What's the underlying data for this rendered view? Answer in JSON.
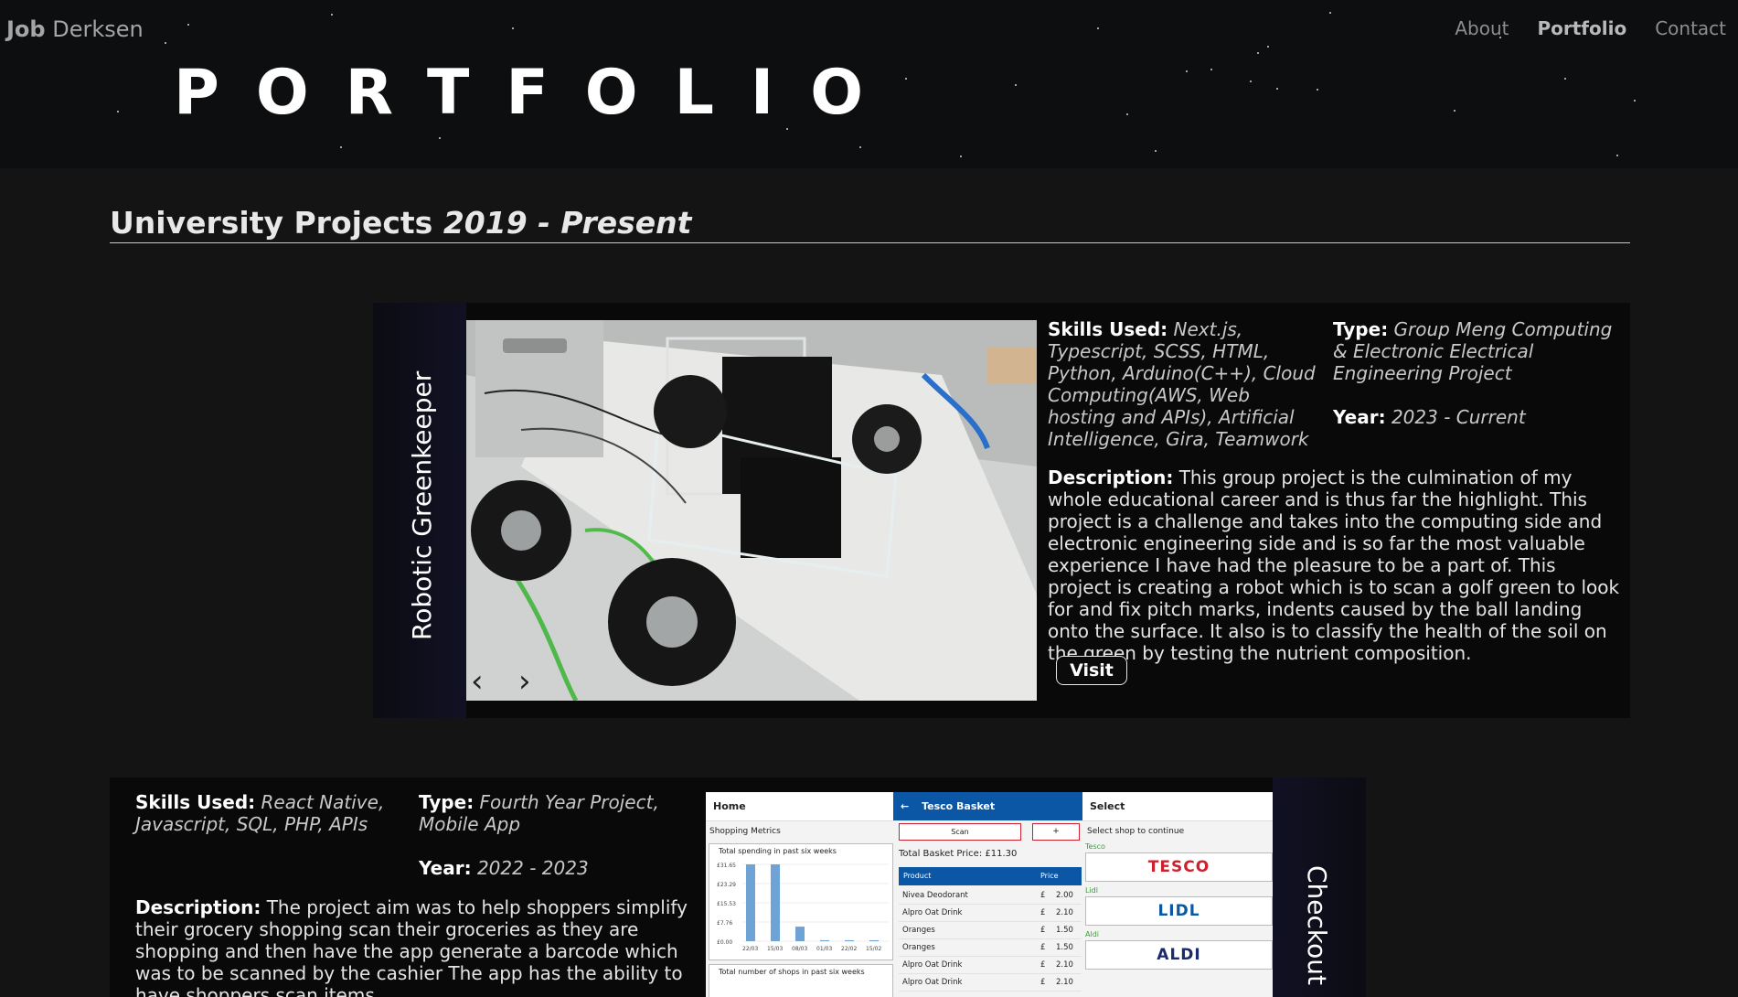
{
  "header": {
    "brand_first": "Job",
    "brand_last": "Derksen",
    "nav": [
      "About",
      "Portfolio",
      "Contact"
    ],
    "active_nav": "Portfolio",
    "title": "PORTFOLIO"
  },
  "section": {
    "title": "University Projects",
    "period": "2019 - Present"
  },
  "project1": {
    "name": "Robotic Greenkeeper",
    "skills_label": "Skills Used:",
    "skills": "Next.js, Typescript, SCSS, HTML, Python, Arduino(C++), Cloud Computing(AWS, Web hosting and APIs), Artificial Intelligence, Gira, Teamwork",
    "type_label": "Type:",
    "type": "Group Meng Computing & Electronic Electrical Engineering Project",
    "year_label": "Year:",
    "year": "2023 - Current",
    "desc_label": "Description:",
    "description": "This group project is the culmination of my whole educational career and is thus far the highlight. This project is a challenge and takes into the computing side and electronic engineering side and is so far the most valuable experience I have had the pleasure to be a part of. This project is creating a robot which is to scan a golf green to look for and fix pitch marks, indents caused by the ball landing onto the surface. It also is to classify the health of the soil on the green by testing the nutrient composition.",
    "visit": "Visit",
    "prev": "‹",
    "next": "›"
  },
  "project2": {
    "name": "Checkout",
    "skills_label": "Skills Used:",
    "skills": "React Native, Javascript, SQL, PHP, APIs",
    "type_label": "Type:",
    "type": "Fourth Year Project, Mobile App",
    "year_label": "Year:",
    "year": "2022 - 2023",
    "desc_label": "Description:",
    "description": "The project aim was to help shoppers simplify their grocery shopping scan their groceries as they are shopping and then have the app generate a barcode which was to be scanned by the cashier The app has the ability to have shoppers scan items",
    "screens": {
      "home": {
        "title": "Home",
        "metrics": "Shopping Metrics",
        "chart1": "Total spending in past six weeks",
        "ticks": [
          "£31.65",
          "£23.29",
          "£15.53",
          "£7.76",
          "£0.00"
        ],
        "xlabels": [
          "22/03",
          "15/03",
          "08/03",
          "01/03",
          "22/02",
          "15/02"
        ],
        "values": [
          31.65,
          31.65,
          6.0,
          0.4,
          0.4,
          0.4
        ],
        "chart2": "Total number of shops in past six weeks"
      },
      "basket": {
        "title": "Tesco Basket",
        "back": "←",
        "scan": "Scan",
        "plus": "+",
        "total": "Total Basket Price: £11.30",
        "col_product": "Product",
        "col_price": "Price",
        "items": [
          {
            "product": "Nivea Deodorant",
            "cur": "£",
            "price": "2.00"
          },
          {
            "product": "Alpro Oat Drink",
            "cur": "£",
            "price": "2.10"
          },
          {
            "product": "Oranges",
            "cur": "£",
            "price": "1.50"
          },
          {
            "product": "Oranges",
            "cur": "£",
            "price": "1.50"
          },
          {
            "product": "Alpro Oat Drink",
            "cur": "£",
            "price": "2.10"
          },
          {
            "product": "Alpro Oat Drink",
            "cur": "£",
            "price": "2.10"
          }
        ]
      },
      "select": {
        "title": "Select",
        "prompt": "Select shop to continue",
        "shops": [
          {
            "label": "Tesco",
            "logo": "TESCO"
          },
          {
            "label": "Lidl",
            "logo": "LIDL"
          },
          {
            "label": "Aldi",
            "logo": "ALDI"
          }
        ]
      }
    }
  },
  "colors": {
    "background": "#141414",
    "header": "#0d0e0f",
    "card": "#09090a",
    "tesco_blue": "#0b57a6",
    "tesco_red": "#d0202e",
    "chart_bar": "#6fa3d6"
  }
}
